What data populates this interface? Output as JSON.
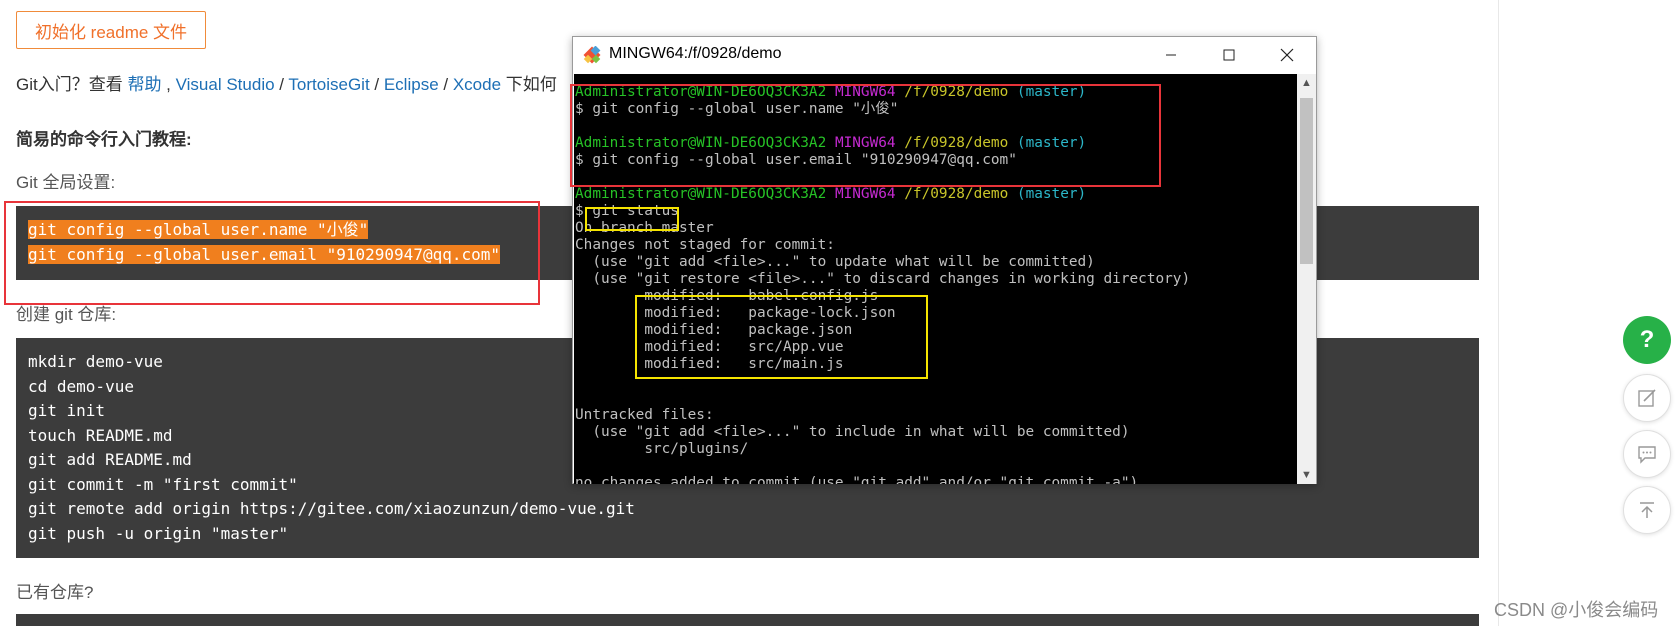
{
  "page": {
    "init_button": "初始化 readme 文件",
    "intro": {
      "prefix": "Git入门？查看 ",
      "link_help": "帮助",
      "sep1": " , ",
      "link_vs": "Visual Studio",
      "sep2": " / ",
      "link_tortoise": "TortoiseGit",
      "sep3": " / ",
      "link_eclipse": "Eclipse",
      "sep4": " / ",
      "link_xcode": "Xcode",
      "suffix": " 下如何"
    },
    "section_title": "简易的命令行入门教程:",
    "global_setup_label": "Git 全局设置:",
    "global_setup_lines": [
      "git config --global user.name \"小俊\"",
      "git config --global user.email \"910290947@qq.com\""
    ],
    "create_repo_label": "创建 git 仓库:",
    "create_repo_lines": [
      "mkdir demo-vue",
      "cd demo-vue",
      "git init",
      "touch README.md",
      "git add README.md",
      "git commit -m \"first commit\"",
      "git remote add origin https://gitee.com/xiaozunzun/demo-vue.git",
      "git push -u origin \"master\""
    ],
    "existing_repo_label": "已有仓库?"
  },
  "terminal": {
    "title": "MINGW64:/f/0928/demo",
    "prompt_user": "Administrator@WIN-DE6OQ3CK3A2",
    "prompt_env": "MINGW64",
    "prompt_path": "/f/0928/demo",
    "prompt_branch": "(master)",
    "cmd1": "$ git config --global user.name \"小俊\"",
    "cmd2": "$ git config --global user.email \"910290947@qq.com\"",
    "cmd3_dollar": "$ ",
    "cmd3": "git status",
    "out": [
      "On branch master",
      "Changes not staged for commit:",
      "  (use \"git add <file>...\" to update what will be committed)",
      "  (use \"git restore <file>...\" to discard changes in working directory)"
    ],
    "modified_label": "modified:",
    "modified_files": [
      "babel.config.js",
      "package-lock.json",
      "package.json",
      "src/App.vue",
      "src/main.js"
    ],
    "untracked_header": "Untracked files:",
    "untracked_hint": "  (use \"git add <file>...\" to include in what will be committed)",
    "untracked_file": "src/plugins/",
    "final_line": "no changes added to commit (use \"git add\" and/or \"git commit -a\")"
  },
  "sidebar": {
    "help_icon_glyph": "?"
  },
  "watermark": "CSDN @小俊会编码",
  "colors": {
    "accent_orange": "#f0702a",
    "highlight_orange": "#f07f1e",
    "link_blue": "#1d6fb5",
    "annotation_red": "#e8343a",
    "annotation_yellow": "#f5e400",
    "help_green": "#27b148"
  }
}
